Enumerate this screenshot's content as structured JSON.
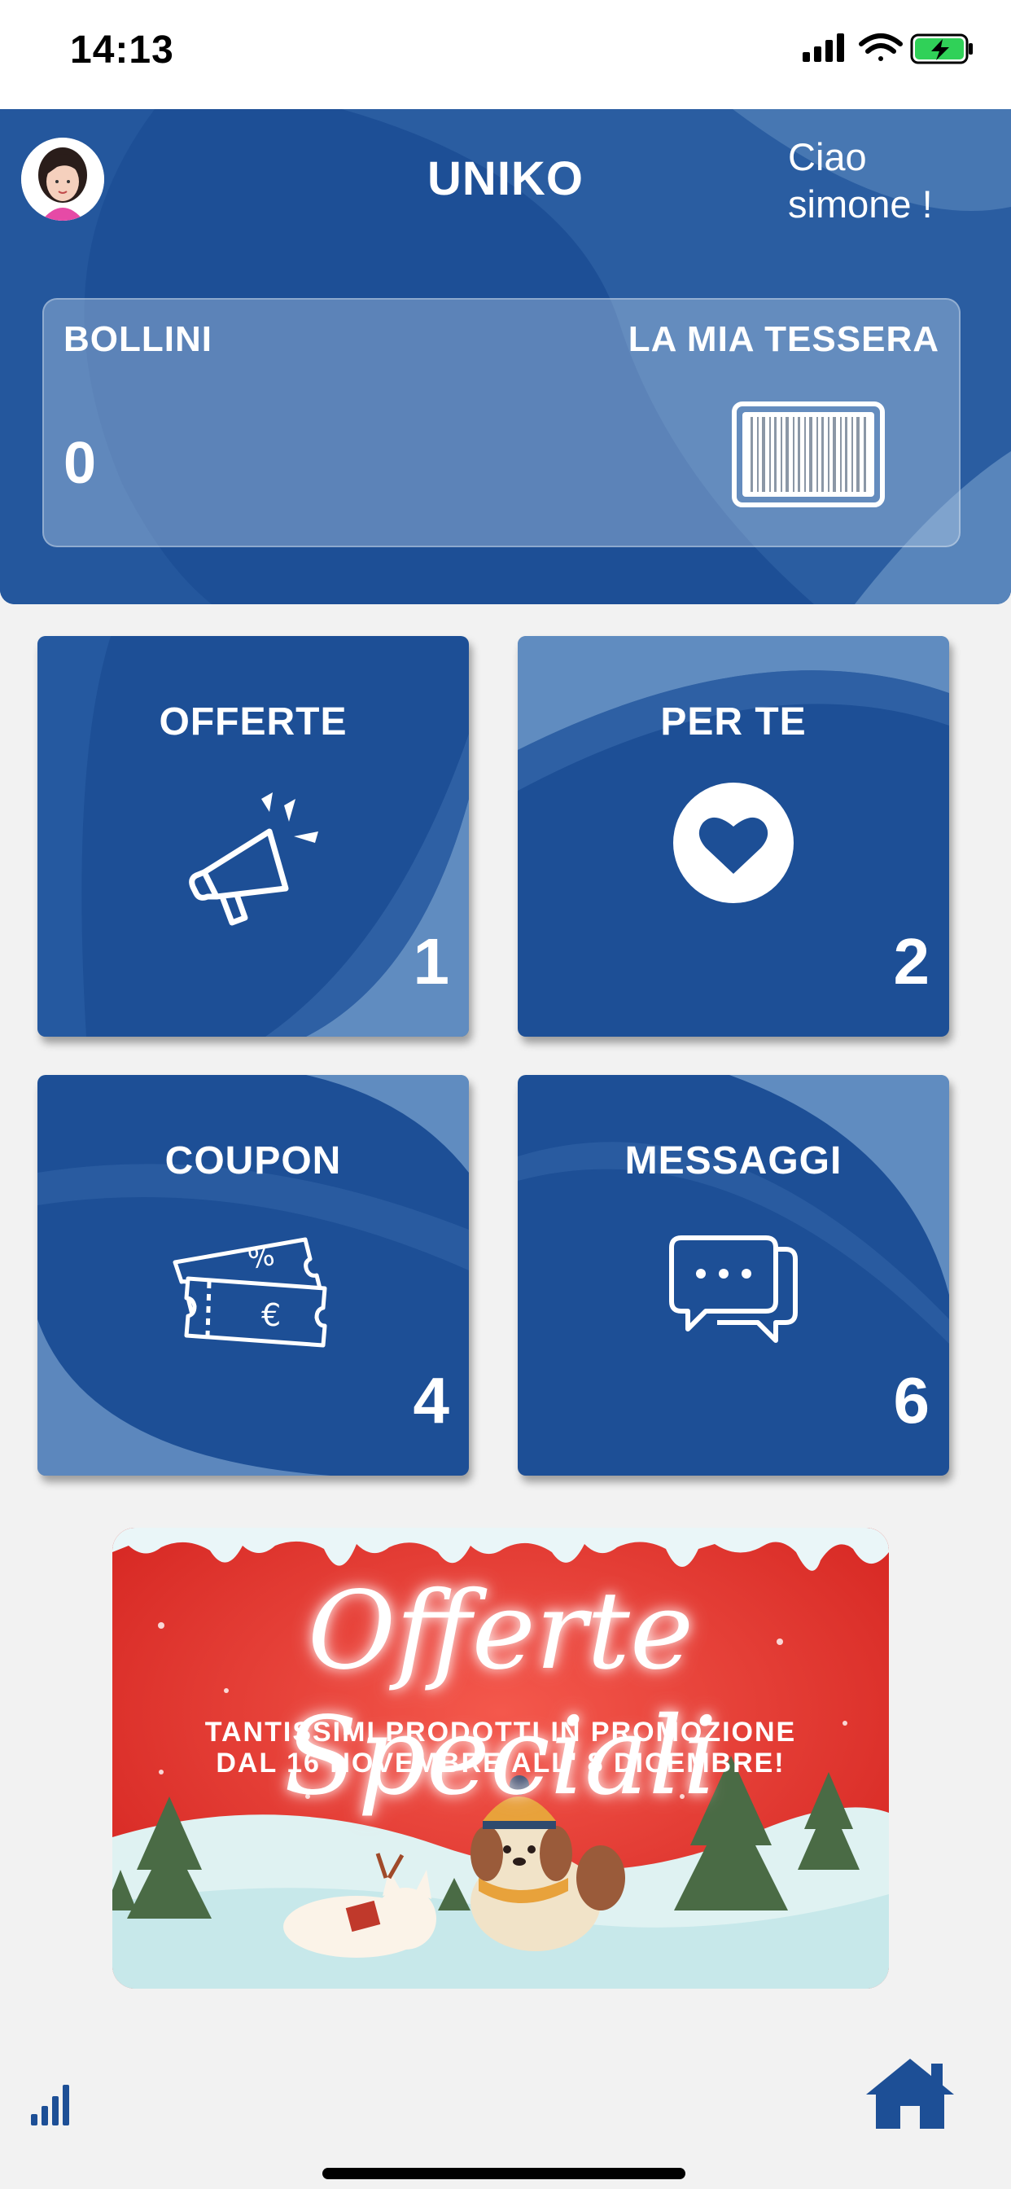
{
  "status_bar": {
    "time": "14:13",
    "icons": [
      "cellular-signal-icon",
      "wifi-icon",
      "battery-charging-icon"
    ],
    "battery_color": "#30d158"
  },
  "header": {
    "title": "UNIKO",
    "greeting": "Ciao simone !",
    "avatar": "user-avatar",
    "card": {
      "bollini_label": "BOLLINI",
      "bollini_value": "0",
      "tessera_label": "LA MIA TESSERA",
      "tessera_icon": "barcode-icon"
    }
  },
  "tiles": [
    {
      "label": "OFFERTE",
      "count": "1",
      "icon": "megaphone-icon"
    },
    {
      "label": "PER TE",
      "count": "2",
      "icon": "heart-icon"
    },
    {
      "label": "COUPON",
      "count": "4",
      "icon": "coupon-icon"
    },
    {
      "label": "MESSAGGI",
      "count": "6",
      "icon": "chat-icon"
    }
  ],
  "banner": {
    "title": "Offerte Speciali",
    "line1": "TANTISSIMI PRODOTTI IN PROMOZIONE",
    "line2": "DAL 16 NOVEMBRE ALL' 8 DICEMBRE!"
  },
  "bottom_bar": {
    "left_icon": "signal-bars-icon",
    "right_icon": "home-icon"
  },
  "colors": {
    "brand_blue": "#1d4f96",
    "light_blue": "#6f9cc9",
    "banner_red": "#e83a32",
    "background": "#f2f2f2"
  }
}
